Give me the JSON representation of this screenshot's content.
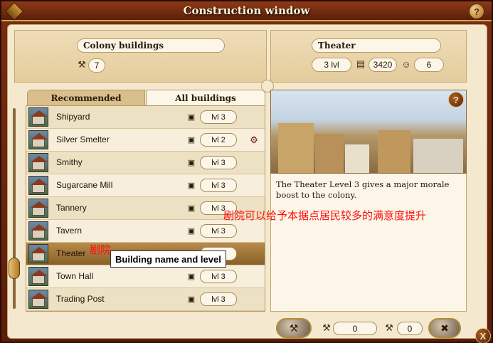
{
  "window": {
    "title": "Construction window",
    "help_glyph": "?",
    "close_glyph": "X"
  },
  "colony": {
    "label": "Colony buildings",
    "value": "7"
  },
  "selected": {
    "name": "Theater",
    "level": "3 lvl",
    "cost": "3420",
    "morale": "6"
  },
  "tabs": {
    "recommended": "Recommended",
    "all": "All buildings"
  },
  "buildings": [
    {
      "name": "Shipyard",
      "level": "lvl 3"
    },
    {
      "name": "Silver Smelter",
      "level": "lvl 2"
    },
    {
      "name": "Smithy",
      "level": "lvl 3"
    },
    {
      "name": "Sugarcane Mill",
      "level": "lvl 3"
    },
    {
      "name": "Tannery",
      "level": "lvl 3"
    },
    {
      "name": "Tavern",
      "level": "lvl 3"
    },
    {
      "name": "Theater",
      "level": ""
    },
    {
      "name": "Town Hall",
      "level": "lvl 3"
    },
    {
      "name": "Trading Post",
      "level": "lvl 3"
    }
  ],
  "tooltip": "Building name and level",
  "annotations": {
    "theater_cn": "剧院",
    "effect_cn": "剧院可以给予本据点居民较多的满意度提升"
  },
  "description": "The Theater Level 3 gives a major morale boost to the colony.",
  "bottom": {
    "value1": "0",
    "value2": "0"
  },
  "icons": {
    "hammer": "hammer-icon",
    "building": "building-icon",
    "money": "money-icon",
    "morale": "theater-masks-icon",
    "help": "help-icon",
    "close": "close-icon",
    "build": "build-icon",
    "demolish": "demolish-icon"
  },
  "colors": {
    "accent": "#d4a55a",
    "frame": "#6a2410",
    "panel": "#f4e9cf"
  }
}
